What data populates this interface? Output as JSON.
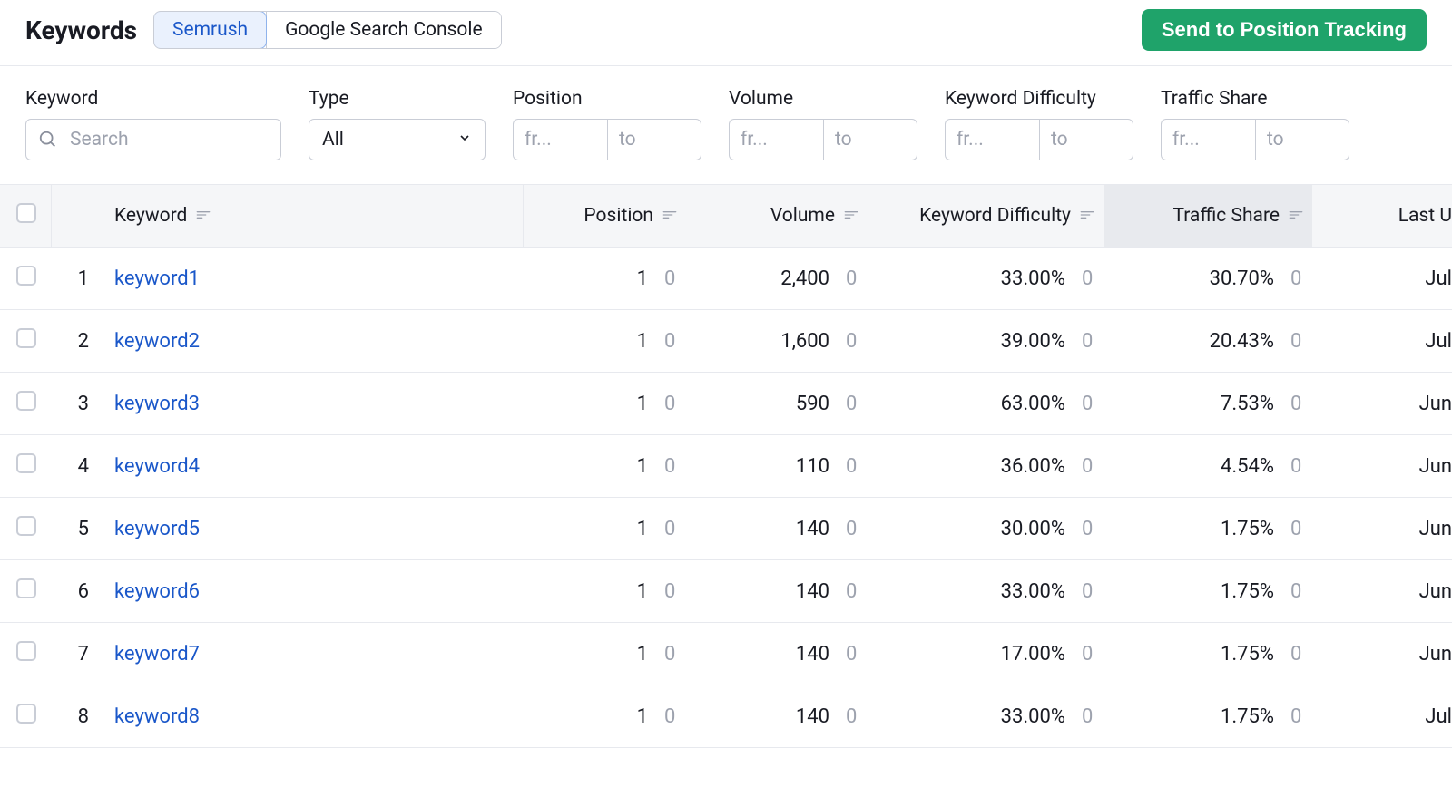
{
  "header": {
    "title": "Keywords",
    "tabs": [
      {
        "id": "semrush",
        "label": "Semrush",
        "active": true
      },
      {
        "id": "gsc",
        "label": "Google Search Console",
        "active": false
      }
    ],
    "cta_label": "Send to Position Tracking"
  },
  "filters": {
    "keyword": {
      "label": "Keyword",
      "search_placeholder": "Search"
    },
    "type": {
      "label": "Type",
      "selected": "All"
    },
    "position": {
      "label": "Position",
      "from_placeholder": "fr...",
      "to_placeholder": "to"
    },
    "volume": {
      "label": "Volume",
      "from_placeholder": "fr...",
      "to_placeholder": "to"
    },
    "kd": {
      "label": "Keyword Difficulty",
      "from_placeholder": "fr...",
      "to_placeholder": "to"
    },
    "ts": {
      "label": "Traffic Share",
      "from_placeholder": "fr...",
      "to_placeholder": "to"
    }
  },
  "columns": {
    "keyword": "Keyword",
    "position": "Position",
    "volume": "Volume",
    "kd": "Keyword Difficulty",
    "ts": "Traffic Share",
    "last": "Last U"
  },
  "rows": [
    {
      "idx": "1",
      "keyword": "keyword1",
      "position": "1",
      "pos_delta": "0",
      "volume": "2,400",
      "vol_delta": "0",
      "kd": "33.00%",
      "kd_delta": "0",
      "ts": "30.70%",
      "ts_delta": "0",
      "last": "Jul"
    },
    {
      "idx": "2",
      "keyword": "keyword2",
      "position": "1",
      "pos_delta": "0",
      "volume": "1,600",
      "vol_delta": "0",
      "kd": "39.00%",
      "kd_delta": "0",
      "ts": "20.43%",
      "ts_delta": "0",
      "last": "Jul"
    },
    {
      "idx": "3",
      "keyword": "keyword3",
      "position": "1",
      "pos_delta": "0",
      "volume": "590",
      "vol_delta": "0",
      "kd": "63.00%",
      "kd_delta": "0",
      "ts": "7.53%",
      "ts_delta": "0",
      "last": "Jun"
    },
    {
      "idx": "4",
      "keyword": "keyword4",
      "position": "1",
      "pos_delta": "0",
      "volume": "110",
      "vol_delta": "0",
      "kd": "36.00%",
      "kd_delta": "0",
      "ts": "4.54%",
      "ts_delta": "0",
      "last": "Jun"
    },
    {
      "idx": "5",
      "keyword": "keyword5",
      "position": "1",
      "pos_delta": "0",
      "volume": "140",
      "vol_delta": "0",
      "kd": "30.00%",
      "kd_delta": "0",
      "ts": "1.75%",
      "ts_delta": "0",
      "last": "Jun"
    },
    {
      "idx": "6",
      "keyword": "keyword6",
      "position": "1",
      "pos_delta": "0",
      "volume": "140",
      "vol_delta": "0",
      "kd": "33.00%",
      "kd_delta": "0",
      "ts": "1.75%",
      "ts_delta": "0",
      "last": "Jun"
    },
    {
      "idx": "7",
      "keyword": "keyword7",
      "position": "1",
      "pos_delta": "0",
      "volume": "140",
      "vol_delta": "0",
      "kd": "17.00%",
      "kd_delta": "0",
      "ts": "1.75%",
      "ts_delta": "0",
      "last": "Jun"
    },
    {
      "idx": "8",
      "keyword": "keyword8",
      "position": "1",
      "pos_delta": "0",
      "volume": "140",
      "vol_delta": "0",
      "kd": "33.00%",
      "kd_delta": "0",
      "ts": "1.75%",
      "ts_delta": "0",
      "last": "Jul"
    }
  ]
}
